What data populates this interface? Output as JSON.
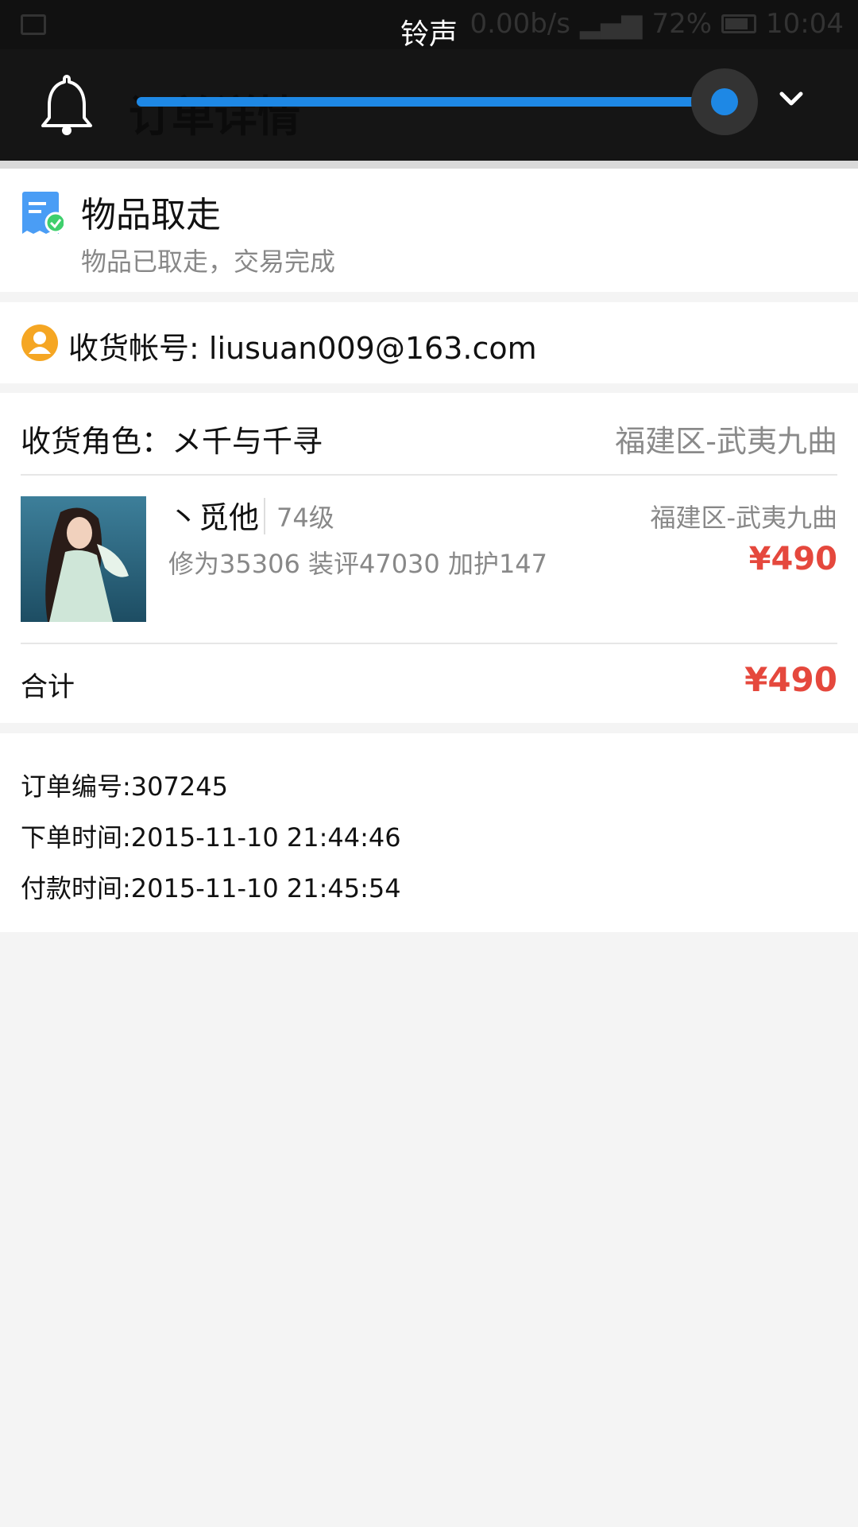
{
  "status_bar": {
    "network_speed": "0.00b/s",
    "battery": "72%",
    "time": "10:04"
  },
  "volume_overlay": {
    "title": "铃声",
    "level": 0.9
  },
  "header": {
    "title": "订单详情"
  },
  "order_status": {
    "title": "物品取走",
    "subtitle": "物品已取走，交易完成"
  },
  "account": {
    "label": "收货帐号: liusuan009@163.com"
  },
  "order": {
    "role_label": "收货角色：メ千与千寻",
    "role_server": "福建区-武夷九曲",
    "item": {
      "name": "丶觅他",
      "level": "74级",
      "stats": "修为35306 装评47030 加护147",
      "server": "福建区-武夷九曲",
      "price": "¥490"
    },
    "total_label": "合计",
    "total_price": "¥490"
  },
  "info": {
    "order_no": "订单编号:307245",
    "order_time": "下单时间:2015-11-10 21:44:46",
    "pay_time": "付款时间:2015-11-10 21:45:54"
  },
  "colors": {
    "accent_blue": "#1e88e5",
    "price_red": "#e5483d",
    "avatar_orange": "#f5a623"
  }
}
